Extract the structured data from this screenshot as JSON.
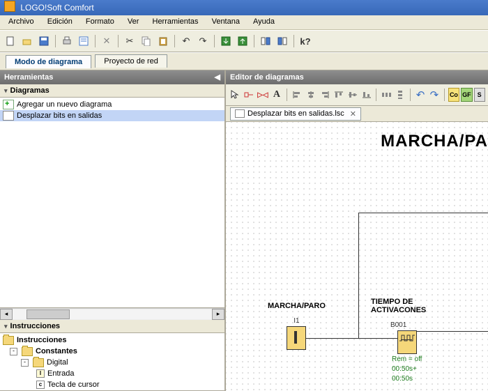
{
  "app": {
    "title": "LOGO!Soft Comfort"
  },
  "menu": {
    "items": [
      "Archivo",
      "Edición",
      "Formato",
      "Ver",
      "Herramientas",
      "Ventana",
      "Ayuda"
    ]
  },
  "tabs": {
    "mode": "Modo de diagrama",
    "project": "Proyecto de red"
  },
  "left": {
    "tools_hdr": "Herramientas",
    "diagrams_hdr": "Diagramas",
    "tree": {
      "add": "Agregar un nuevo diagrama",
      "file": "Desplazar bits en salidas"
    },
    "instr_hdr": "Instrucciones",
    "instr_root": "Instrucciones",
    "constants": "Constantes",
    "digital": "Digital",
    "entrada": "Entrada",
    "tecla": "Tecla de cursor"
  },
  "editor": {
    "hdr": "Editor de diagramas",
    "filetab": "Desplazar bits en salidas.lsc",
    "big_title": "MARCHA/PA",
    "block1": {
      "label": "MARCHA/PARO",
      "id": "I1"
    },
    "block2": {
      "label1": "TIEMPO DE",
      "label2": "ACTIVACONES",
      "id": "B001",
      "ann1": "Rem = off",
      "ann2": "00:50s+",
      "ann3": "00:50s"
    },
    "badges": {
      "co": "Co",
      "gf": "GF",
      "s": "S"
    }
  }
}
